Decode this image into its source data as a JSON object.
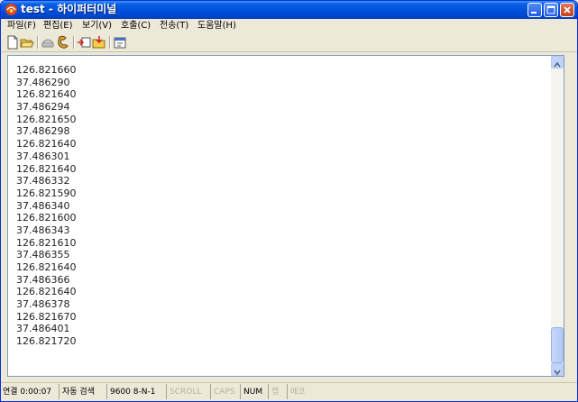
{
  "window": {
    "title": "test - 하이퍼터미널"
  },
  "menu": {
    "items": [
      "파일(F)",
      "편집(E)",
      "보기(V)",
      "호출(C)",
      "전송(T)",
      "도움말(H)"
    ]
  },
  "toolbar": {
    "icons": [
      "new-icon",
      "open-icon",
      "call-icon",
      "disconnect-icon",
      "send-icon",
      "receive-icon",
      "properties-icon"
    ]
  },
  "terminal": {
    "lines": [
      "126.821660",
      "37.486290",
      "126.821640",
      "37.486294",
      "126.821650",
      "37.486298",
      "126.821640",
      "37.486301",
      "126.821640",
      "37.486332",
      "126.821590",
      "37.486340",
      "126.821600",
      "37.486343",
      "126.821610",
      "37.486355",
      "126.821640",
      "37.486366",
      "126.821640",
      "37.486378",
      "126.821670",
      "37.486401",
      "126.821720"
    ]
  },
  "status": {
    "connection": "연결 0:00:07",
    "detect": "자동 검색",
    "port_settings": "9600 8-N-1",
    "scroll": "SCROLL",
    "caps": "CAPS",
    "num": "NUM",
    "capture": "캡",
    "echo": "에코"
  },
  "colors": {
    "titlebar": "#0053e0",
    "close_button": "#c2401d",
    "chrome": "#ece9d8"
  }
}
